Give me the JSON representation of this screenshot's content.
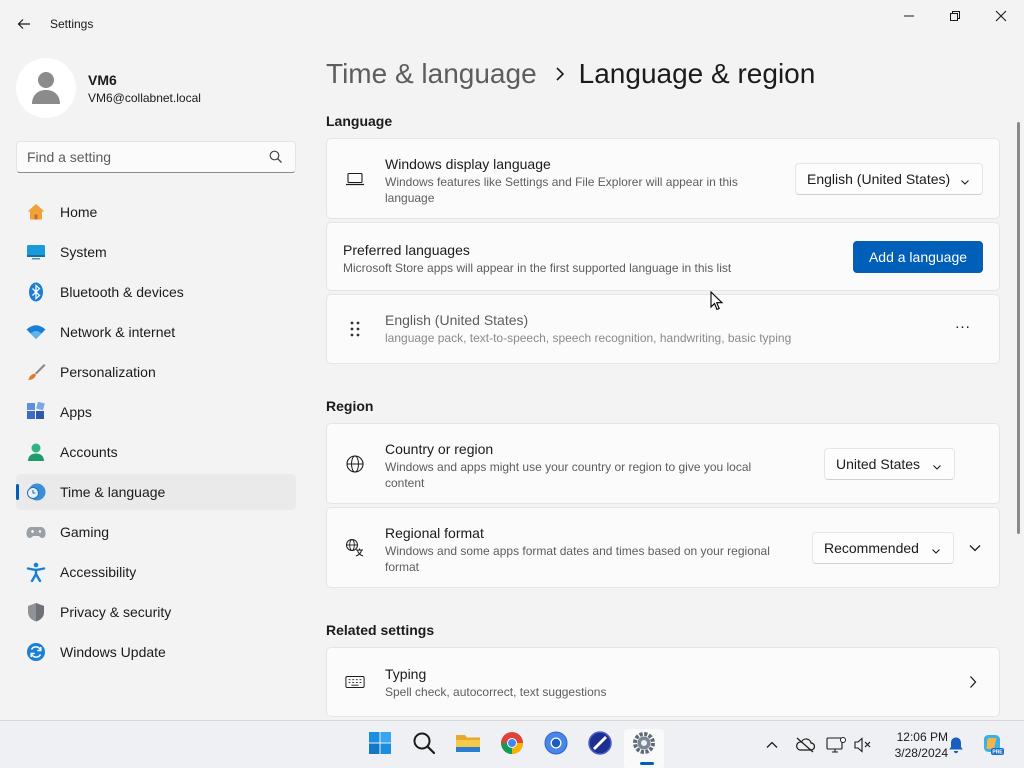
{
  "window": {
    "title": "Settings"
  },
  "profile": {
    "name": "VM6",
    "email": "VM6@collabnet.local"
  },
  "search": {
    "placeholder": "Find a setting"
  },
  "nav": [
    {
      "label": "Home",
      "icon": "home-icon"
    },
    {
      "label": "System",
      "icon": "system-icon"
    },
    {
      "label": "Bluetooth & devices",
      "icon": "bluetooth-icon"
    },
    {
      "label": "Network & internet",
      "icon": "wifi-icon"
    },
    {
      "label": "Personalization",
      "icon": "brush-icon"
    },
    {
      "label": "Apps",
      "icon": "apps-icon"
    },
    {
      "label": "Accounts",
      "icon": "accounts-icon"
    },
    {
      "label": "Time & language",
      "icon": "time-language-icon",
      "active": true
    },
    {
      "label": "Gaming",
      "icon": "gamepad-icon"
    },
    {
      "label": "Accessibility",
      "icon": "accessibility-icon"
    },
    {
      "label": "Privacy & security",
      "icon": "shield-icon"
    },
    {
      "label": "Windows Update",
      "icon": "update-icon"
    }
  ],
  "breadcrumb": {
    "parent": "Time & language",
    "current": "Language & region"
  },
  "language": {
    "heading": "Language",
    "display": {
      "title": "Windows display language",
      "desc": "Windows features like Settings and File Explorer will appear in this language",
      "value": "English (United States)"
    },
    "preferred": {
      "title": "Preferred languages",
      "desc": "Microsoft Store apps will appear in the first supported language in this list",
      "button": "Add a language"
    },
    "installed": {
      "title": "English (United States)",
      "desc": "language pack, text-to-speech, speech recognition, handwriting, basic typing",
      "more": "..."
    }
  },
  "region": {
    "heading": "Region",
    "country": {
      "title": "Country or region",
      "desc": "Windows and apps might use your country or region to give you local content",
      "value": "United States"
    },
    "format": {
      "title": "Regional format",
      "desc": "Windows and some apps format dates and times based on your regional format",
      "value": "Recommended"
    }
  },
  "related": {
    "heading": "Related settings",
    "typing": {
      "title": "Typing",
      "desc": "Spell check, autocorrect, text suggestions"
    }
  },
  "taskbar": {
    "apps": [
      "start-icon",
      "search-icon",
      "file-explorer-icon",
      "chrome-icon",
      "chrome-beta-icon",
      "shortcut-app-icon",
      "settings-icon"
    ],
    "time": "12:06 PM",
    "date": "3/28/2024",
    "accent": "#005fb8"
  }
}
